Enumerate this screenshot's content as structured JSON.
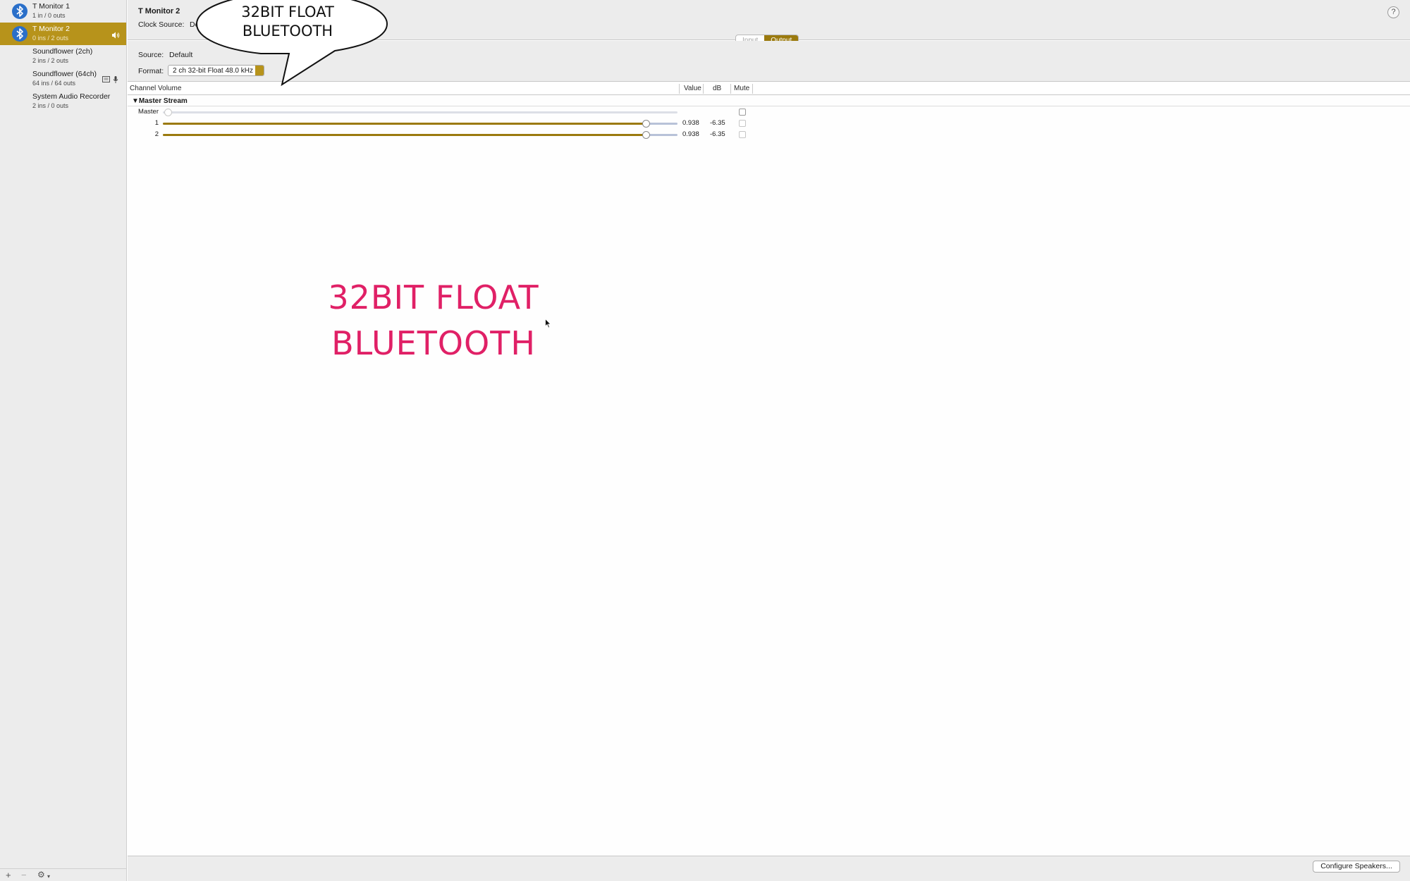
{
  "sidebar": {
    "devices": [
      {
        "name": "T Monitor 1",
        "sub": "1 in / 0 outs",
        "icon": "bluetooth-icon"
      },
      {
        "name": "T Monitor 2",
        "sub": "0 ins / 2 outs",
        "icon": "bluetooth-icon",
        "selected": true
      },
      {
        "name": "Soundflower (2ch)",
        "sub": "2 ins / 2 outs"
      },
      {
        "name": "Soundflower (64ch)",
        "sub": "64 ins / 64 outs"
      },
      {
        "name": "System Audio Recorder",
        "sub": "2 ins / 0 outs"
      }
    ],
    "toolbar": {
      "add": "+",
      "remove": "−",
      "gear": "⚙"
    }
  },
  "header": {
    "device_title": "T Monitor 2",
    "clock_label": "Clock Source:",
    "clock_value": "De",
    "help": "?",
    "tabs": [
      {
        "label": "Input",
        "active": false
      },
      {
        "label": "Output",
        "active": true
      }
    ]
  },
  "format_area": {
    "source_label": "Source:",
    "source_value": "Default",
    "format_label": "Format:",
    "format_value": "2 ch 32-bit Float 48.0 kHz"
  },
  "table": {
    "headers": {
      "channel": "Channel Volume",
      "value": "Value",
      "db": "dB",
      "mute": "Mute"
    },
    "stream": "▼Master Stream",
    "rows": [
      {
        "label": "Master",
        "level": 0.0,
        "value": "",
        "db": "",
        "disabled": true
      },
      {
        "label": "1",
        "level": 0.938,
        "value": "0.938",
        "db": "-6.35"
      },
      {
        "label": "2",
        "level": 0.938,
        "value": "0.938",
        "db": "-6.35"
      }
    ]
  },
  "footer": {
    "configure": "Configure Speakers..."
  },
  "overlay": {
    "bubble_line1": "32BIT FLOAT",
    "bubble_line2": "BLUETOOTH",
    "big_line1": "32BIT FLOAT",
    "big_line2": "BLUETOOTH"
  },
  "colors": {
    "accent": "#b7931b",
    "accent_dark": "#9b7a0e",
    "overlay_text": "#e02066"
  }
}
